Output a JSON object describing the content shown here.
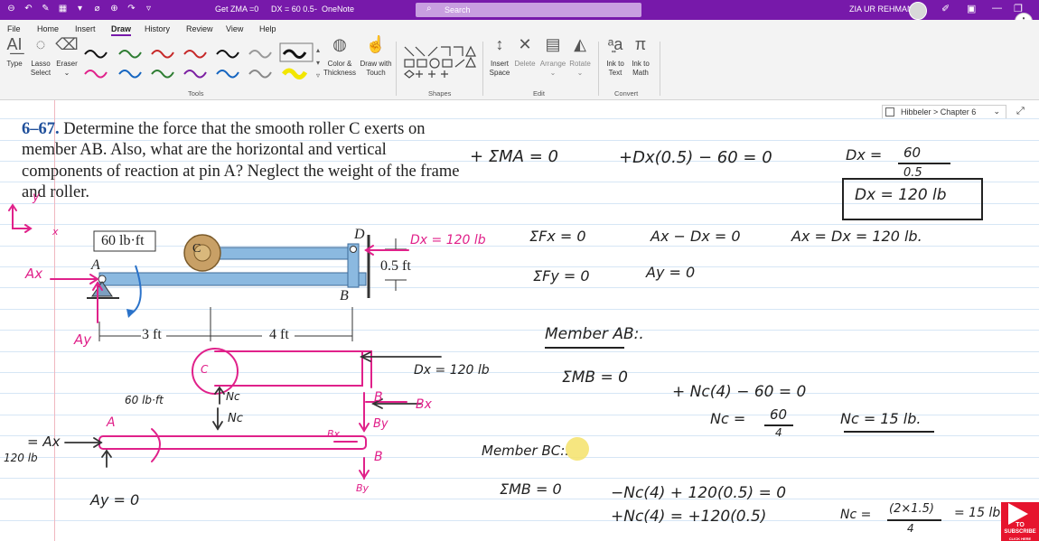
{
  "titlebar": {
    "doc1": "Get ZMA =0",
    "doc2": "DX = 60 0.5",
    "app": "OneNote",
    "search_placeholder": "Search",
    "user": "ZIA UR REHMAN",
    "dash": "-"
  },
  "menu": [
    "File",
    "Home",
    "Insert",
    "Draw",
    "History",
    "Review",
    "View",
    "Help"
  ],
  "active_tab": "Draw",
  "ribbon": {
    "type": "Type",
    "lasso": "Lasso",
    "lasso2": "Select",
    "eraser": "Eraser",
    "color_thickness": "Color &",
    "color_thickness2": "Thickness",
    "draw_touch": "Draw with",
    "draw_touch2": "Touch",
    "insert_space": "Insert",
    "insert_space2": "Space",
    "delete": "Delete",
    "arrange": "Arrange",
    "rotate": "Rotate",
    "ink_text": "Ink to",
    "ink_text2": "Text",
    "ink_math": "Ink to",
    "ink_math2": "Math",
    "groups": {
      "tools": "Tools",
      "shapes": "Shapes",
      "edit": "Edit",
      "convert": "Convert"
    }
  },
  "page": {
    "breadcrumb": "Hibbeler > Chapter 6",
    "problem_number": "6–67.",
    "problem_text": "Determine the force that the smooth roller C exerts on member AB. Also, what are the horizontal and vertical components of reaction at pin A? Neglect the weight of the frame and roller.",
    "figure": {
      "moment": "60 lb·ft",
      "roller": "C",
      "pin": "A",
      "joint_b": "B",
      "joint_d": "D",
      "height": "0.5 ft",
      "len1": "3 ft",
      "len2": "4 ft"
    }
  },
  "ink": {
    "axis_y": "y",
    "axis_x": "x",
    "dx_fig": "Dx = 120 lb",
    "ax_fig": "Ax",
    "ay_fig": "Ay",
    "l1_lhs": "+ ΣMA = 0",
    "l1_mid": "+Dx(0.5) − 60 = 0",
    "l1_r1": "Dx =",
    "l1_r2": "60",
    "l1_r3": "0.5",
    "dx_box": "Dx = 120 lb",
    "fx": "ΣFx = 0",
    "fx_eq": "Ax − Dx = 0",
    "fx_res": "Ax = Dx = 120 lb.",
    "fy": "ΣFy = 0",
    "fy_eq": "Ay = 0",
    "member_ab": "Member AB:.",
    "mb": "ΣMB = 0",
    "mb_eq": "+ Nc(4) − 60 = 0",
    "nc1": "Nc =",
    "nc2": "60",
    "nc3": "4",
    "nc_res": "Nc = 15 lb.",
    "member_bc": "Member BC:.",
    "mr": "ΣMB = 0",
    "mr_eq1": "−Nc(4) + 120(0.5) = 0",
    "mr_eq2": "+Nc(4) = +120(0.5)",
    "nc_b1": "Nc =",
    "nc_b2": "(2×1.5)",
    "nc_b3": "4",
    "nc_b4": "= 15 lb",
    "dx2": "Dx = 120 lb",
    "bx": "Bx",
    "by": "By",
    "b_lbl": "B",
    "b_lbl2": "B",
    "c_lbl": "C",
    "nc_up": "Nc",
    "nc_dn": "Nc",
    "ax_b": "= Ax",
    "ax_val": "120 lb",
    "a_lbl": "A",
    "by_lbl": "By",
    "ay_zero": "Ay = 0",
    "mom": "60 lb·ft",
    "bx2": "Bx"
  },
  "youtube": {
    "to": "TO",
    "sub": "SUBSCRIBE",
    "click": "CLICK HERE"
  },
  "colors": {
    "onenote_purple": "#7719aa",
    "ink_pink": "#e0218a",
    "problem_blue": "#1f4f9a"
  }
}
